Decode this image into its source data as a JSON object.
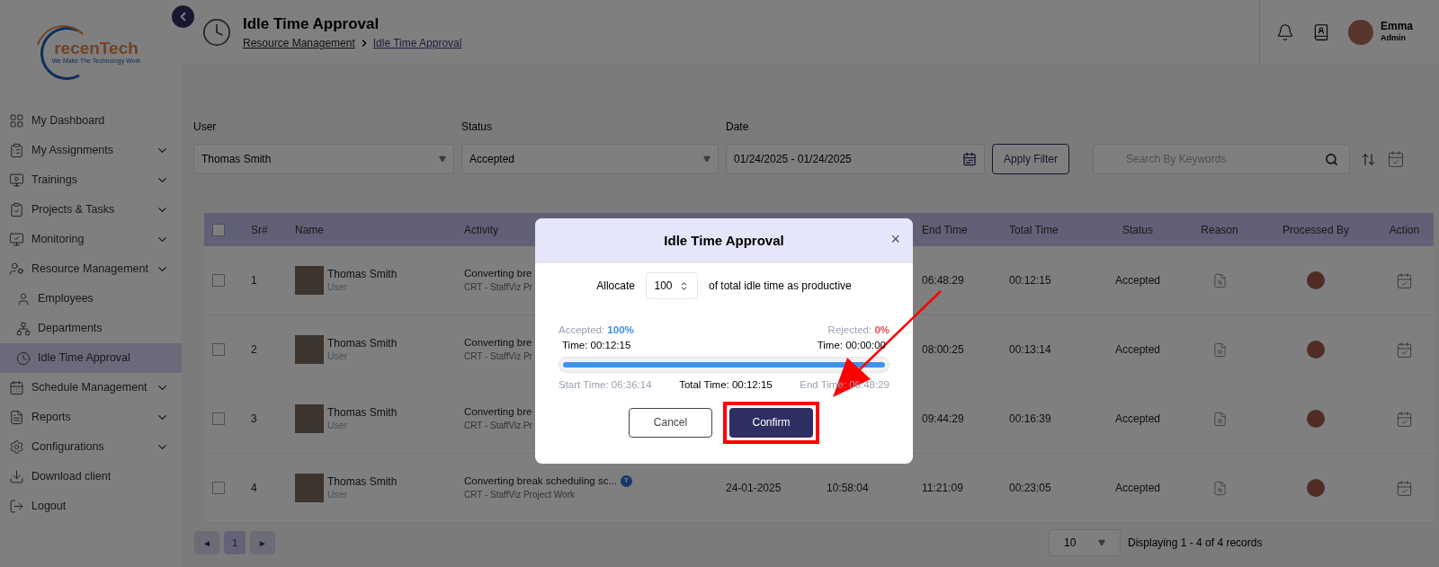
{
  "sidebar": {
    "logo": {
      "name": "recenTech",
      "tagline": "We Make The Technology Work"
    },
    "items": [
      {
        "label": "My Dashboard",
        "expandable": false,
        "selected": false
      },
      {
        "label": "My Assignments",
        "expandable": true,
        "selected": false
      },
      {
        "label": "Trainings",
        "expandable": true,
        "selected": false
      },
      {
        "label": "Projects & Tasks",
        "expandable": true,
        "selected": false
      },
      {
        "label": "Monitoring",
        "expandable": true,
        "selected": false
      },
      {
        "label": "Resource Management",
        "expandable": true,
        "selected": false,
        "children": [
          {
            "label": "Employees",
            "selected": false
          },
          {
            "label": "Departments",
            "selected": false
          },
          {
            "label": "Idle Time Approval",
            "selected": true
          }
        ]
      },
      {
        "label": "Schedule Management",
        "expandable": true,
        "selected": false
      },
      {
        "label": "Reports",
        "expandable": true,
        "selected": false
      },
      {
        "label": "Configurations",
        "expandable": true,
        "selected": false
      },
      {
        "label": "Download client",
        "expandable": false,
        "selected": false
      },
      {
        "label": "Logout",
        "expandable": false,
        "selected": false
      }
    ]
  },
  "header": {
    "title": "Idle Time Approval",
    "breadcrumb": [
      "Resource Management",
      "Idle Time Approval"
    ],
    "user": {
      "name": "Emma",
      "role": "Admin"
    }
  },
  "filters": {
    "user": {
      "label": "User",
      "value": "Thomas Smith"
    },
    "status": {
      "label": "Status",
      "value": "Accepted"
    },
    "date": {
      "label": "Date",
      "value": "01/24/2025 - 01/24/2025"
    },
    "apply_button": "Apply Filter",
    "search": {
      "placeholder": "Search By Keywords"
    }
  },
  "table": {
    "select_all": {
      "checked": false
    },
    "columns": [
      "Sr#",
      "Name",
      "Activity",
      "End Time",
      "Total Time",
      "Status",
      "Reason",
      "Processed By",
      "Action"
    ],
    "rows": [
      {
        "checked": false,
        "sr": "1",
        "name": "Thomas Smith",
        "role": "User",
        "activity": "Converting bre",
        "project": "CRT - StaffViz Pr",
        "end_time": "06:48:29",
        "total_time": "00:12:15",
        "status": "Accepted"
      },
      {
        "checked": false,
        "sr": "2",
        "name": "Thomas Smith",
        "role": "User",
        "activity": "Converting bre",
        "project": "CRT - StaffViz Pr",
        "end_time": "08:00:25",
        "total_time": "00:13:14",
        "status": "Accepted"
      },
      {
        "checked": false,
        "sr": "3",
        "name": "Thomas Smith",
        "role": "User",
        "activity": "Converting bre",
        "project": "CRT - StaffViz Pr",
        "end_time": "09:44:29",
        "total_time": "00:16:39",
        "status": "Accepted"
      },
      {
        "checked": false,
        "sr": "4",
        "name": "Thomas Smith",
        "role": "User",
        "activity": "Converting break scheduling sc...",
        "badge": "T",
        "project": "CRT - StaffViz Project Work",
        "date": "24-01-2025",
        "start_time": "10:58:04",
        "end_time": "11:21:09",
        "total_time": "00:23:05",
        "status": "Accepted"
      }
    ]
  },
  "pagination": {
    "prev": "◄",
    "pages": [
      {
        "label": "1",
        "selected": true
      }
    ],
    "next": "►",
    "page_size": "10",
    "summary": "Displaying 1 - 4 of 4 records"
  },
  "modal": {
    "title": "Idle Time Approval",
    "close": "×",
    "allocate_label": "Allocate",
    "allocate_value": "100",
    "allocate_suffix": "of total idle time as productive",
    "accepted_label": "Accepted:",
    "accepted_value": "100%",
    "rejected_label": "Rejected:",
    "rejected_value": "0%",
    "accepted_time": "Time: 00:12:15",
    "rejected_time": "Time: 00:00:00",
    "level": 1,
    "start_time": "Start Time: 06:36:14",
    "total_time": "Total Time: 00:12:15",
    "end_time": "End Time: 06:48:29",
    "cancel_button": "Cancel",
    "confirm_button": "Confirm"
  }
}
